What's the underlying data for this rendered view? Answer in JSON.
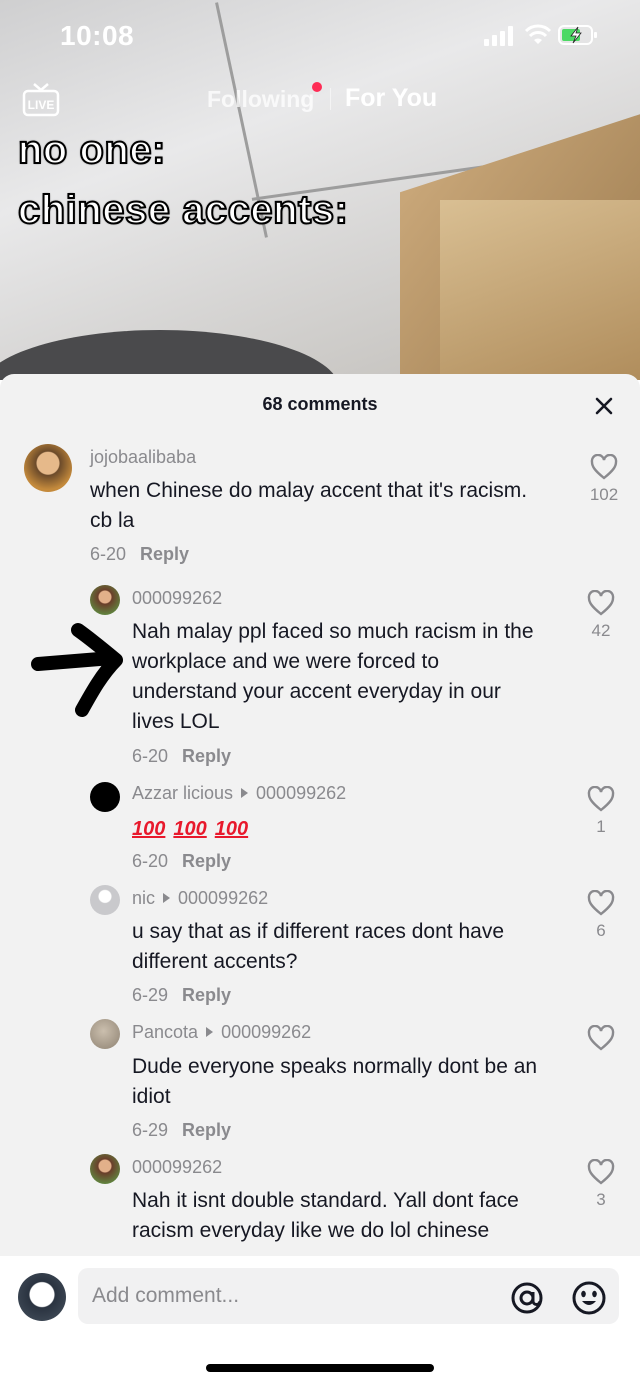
{
  "status_bar": {
    "time": "10:08"
  },
  "top_nav": {
    "following": "Following",
    "for_you": "For You",
    "live_label": "LIVE"
  },
  "video": {
    "caption_line1": "no one:",
    "caption_line2": "chinese accents:"
  },
  "comments_panel": {
    "title": "68 comments",
    "comments": [
      {
        "username": "jojobaalibaba",
        "text_line1": "when Chinese do malay accent that it's racism.",
        "text_line2": "cb la",
        "date": "6-20",
        "reply": "Reply",
        "likes": "102"
      },
      {
        "username": "000099262",
        "text_line1": "Nah malay ppl faced so much racism in the",
        "text_line2": "workplace and we were forced to",
        "text_line3": "understand your accent everyday in our",
        "text_line4": "lives LOL",
        "date": "6-20",
        "reply": "Reply",
        "likes": "42"
      },
      {
        "username": "Azzar licious",
        "reply_to": "000099262",
        "emoji_text": "100",
        "date": "6-20",
        "reply": "Reply",
        "likes": "1"
      },
      {
        "username": "nic",
        "reply_to": "000099262",
        "text_line1": "u say that as if different races dont have",
        "text_line2": "different accents?",
        "date": "6-29",
        "reply": "Reply",
        "likes": "6"
      },
      {
        "username": "Pancota",
        "reply_to": "000099262",
        "text_line1": "Dude everyone speaks normally dont be an",
        "text_line2": "idiot",
        "date": "6-29",
        "reply": "Reply",
        "likes": ""
      },
      {
        "username": "000099262",
        "text_line1": "Nah it isnt double standard. Yall dont face",
        "text_line2": "racism everyday like we do lol chinese",
        "likes": "3"
      }
    ]
  },
  "bottom_bar": {
    "placeholder": "Add comment..."
  },
  "colors": {
    "accent": "#fe2c55",
    "text": "#161823",
    "muted": "#8a8a8e",
    "panel_bg": "#f2f2f2"
  }
}
